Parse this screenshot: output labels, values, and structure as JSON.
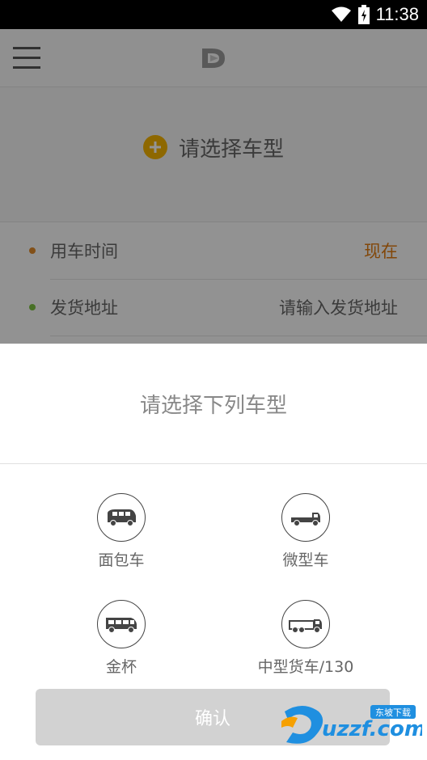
{
  "status_bar": {
    "time": "11:38",
    "icons": [
      "wifi-icon",
      "battery-icon"
    ]
  },
  "header": {
    "menu_icon": "hamburger-menu-icon",
    "logo_icon": "app-logo-icon"
  },
  "vehicle_select": {
    "icon": "plus-circle-icon",
    "label": "请选择车型"
  },
  "form": {
    "rows": [
      {
        "label": "用车时间",
        "value": "现在",
        "dot_color": "#e08a2a",
        "value_color": "#e07a10"
      },
      {
        "label": "发货地址",
        "value": "请输入发货地址",
        "dot_color": "#7cc242"
      }
    ]
  },
  "dialog": {
    "title": "请选择下列车型",
    "options": [
      {
        "label": "面包车",
        "icon": "minibus-icon"
      },
      {
        "label": "微型车",
        "icon": "micro-truck-icon"
      },
      {
        "label": "金杯",
        "icon": "van-icon"
      },
      {
        "label": "中型货车/130",
        "icon": "medium-truck-icon"
      }
    ],
    "confirm_label": "确认"
  },
  "watermark": {
    "text": "uzzf.com",
    "sub_text": "东坡下载"
  },
  "colors": {
    "accent_orange": "#e07a10",
    "plus_yellow": "#f4b400",
    "green_dot": "#7cc242",
    "confirm_disabled": "#d2d2d2"
  }
}
